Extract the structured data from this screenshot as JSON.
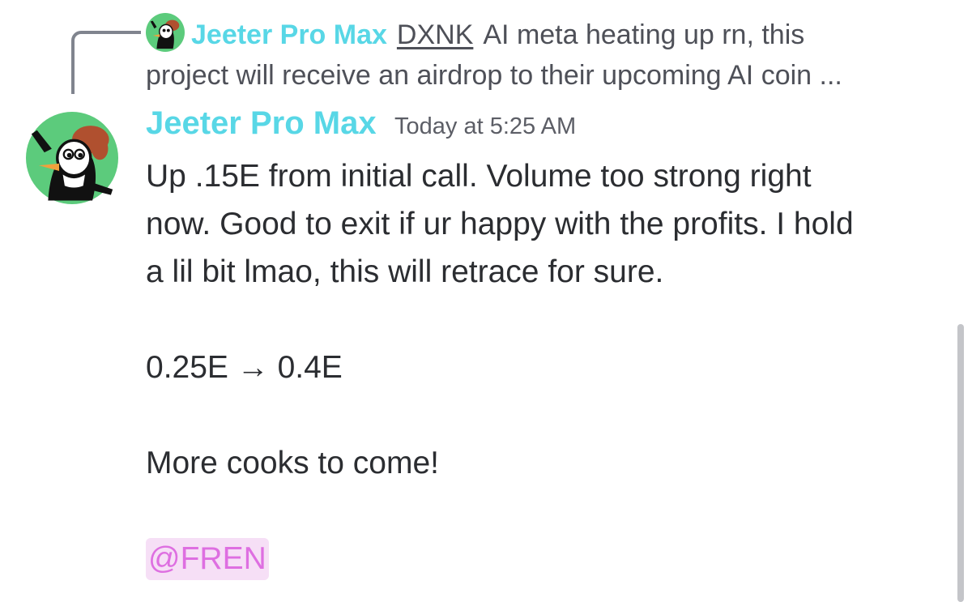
{
  "reply": {
    "author": "Jeeter Pro Max",
    "tag": "DXNK",
    "line1": "AI meta heating up rn, this",
    "line2": "project will receive an airdrop to their upcoming AI coin ..."
  },
  "message": {
    "author": "Jeeter Pro Max",
    "timestamp": "Today at 5:25 AM",
    "lines": [
      "Up .15E from initial call. Volume too strong right",
      "now. Good to exit if ur happy with the profits. I hold",
      "a lil bit lmao, this will retrace for sure."
    ],
    "price_change": "0.25E → 0.4E",
    "closing": "More cooks to come!",
    "mention": "@FREN"
  },
  "colors": {
    "author": "#58d7e6",
    "mention_text": "#de6fe1",
    "mention_bg": "#f6dff6",
    "avatar_bg": "#5ccb7c"
  },
  "icons": {
    "avatar": "cartoon-woodpecker-avatar-icon"
  }
}
